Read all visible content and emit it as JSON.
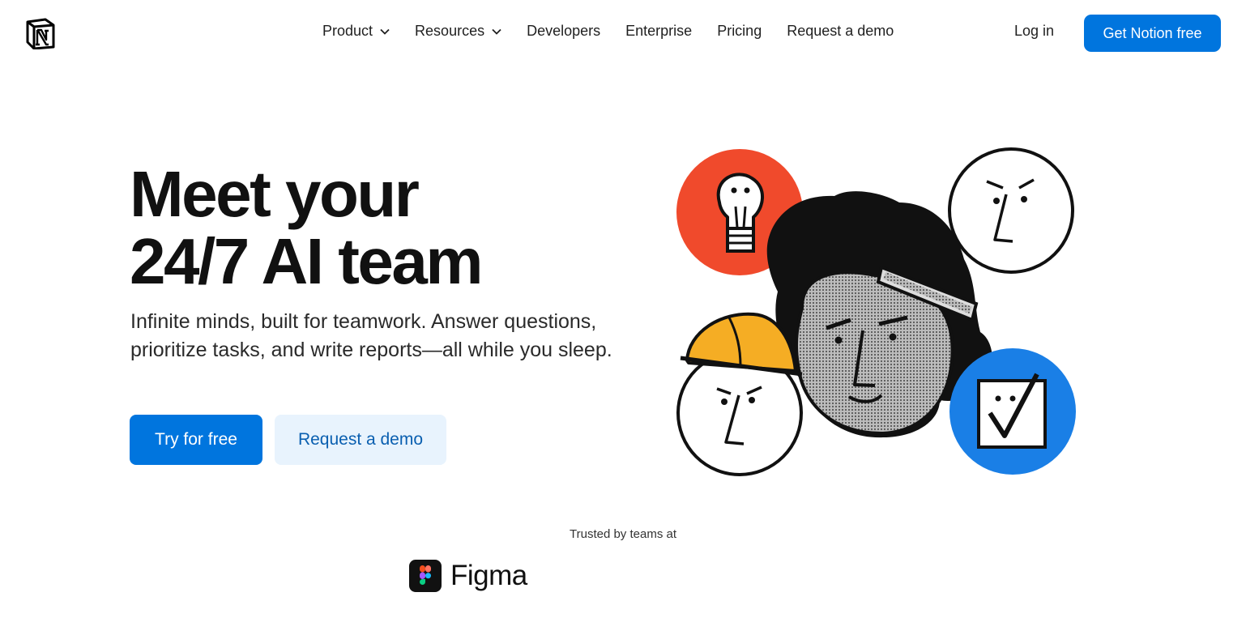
{
  "header": {
    "logo_icon": "notion-logo-icon",
    "nav": [
      {
        "label": "Product",
        "has_dropdown": true
      },
      {
        "label": "Resources",
        "has_dropdown": true
      },
      {
        "label": "Developers",
        "has_dropdown": false
      },
      {
        "label": "Enterprise",
        "has_dropdown": false
      },
      {
        "label": "Pricing",
        "has_dropdown": false
      },
      {
        "label": "Request a demo",
        "has_dropdown": false
      }
    ],
    "login_label": "Log in",
    "cta_label": "Get Notion free"
  },
  "hero": {
    "title_line1": "Meet your",
    "title_line2": "24/7 AI team",
    "subtitle": "Infinite minds, built for teamwork. Answer questions, prioritize tasks, and write reports—all while you sleep.",
    "primary_button": "Try for free",
    "secondary_button": "Request a demo"
  },
  "trusted": {
    "label": "Trusted by teams at",
    "logos": [
      {
        "name": "Figma",
        "icon": "figma-icon"
      }
    ]
  },
  "colors": {
    "accent": "#0075de",
    "accent_light": "#e8f3fd",
    "illus_red": "#f04a2c",
    "illus_blue": "#1a7fe6",
    "illus_yellow": "#f5ad24"
  }
}
